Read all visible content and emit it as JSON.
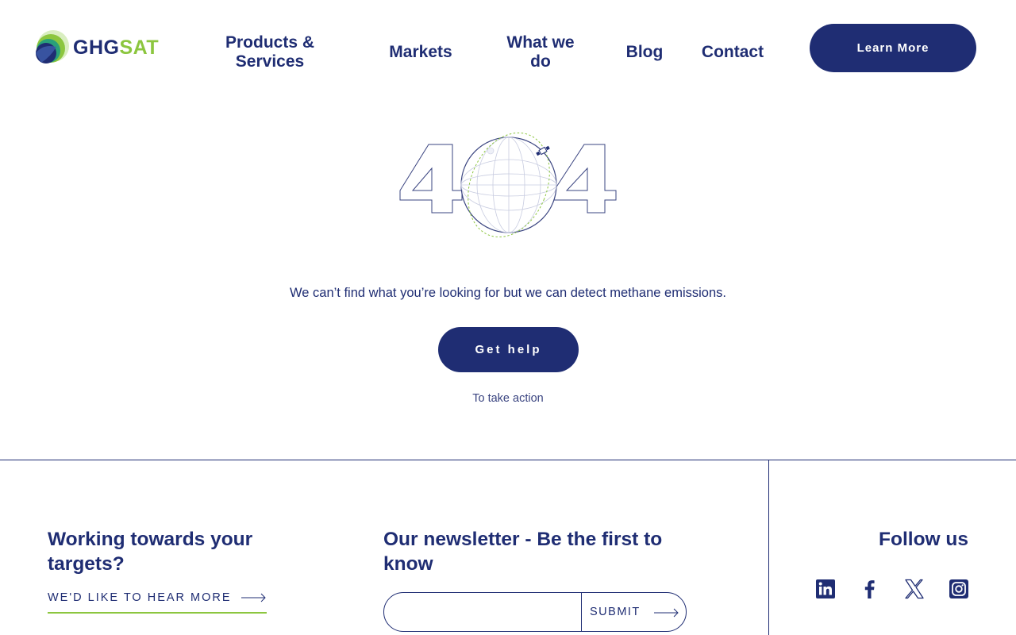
{
  "brand": {
    "logo_primary": "GHG",
    "logo_accent": "SAT",
    "navy": "#1f2d73",
    "green": "#8cc63f"
  },
  "nav": {
    "items": [
      {
        "label": "Products & Services"
      },
      {
        "label": "Markets"
      },
      {
        "label": "What we do"
      },
      {
        "label": "Blog"
      },
      {
        "label": "Contact"
      }
    ],
    "cta_label": "Learn More"
  },
  "error": {
    "code_left": "4",
    "code_right": "4",
    "message": "We can’t find what you’re looking for but we can detect methane emissions.",
    "help_button": "Get help",
    "help_caption": "To take action"
  },
  "footer": {
    "targets_heading": "Working towards your targets?",
    "hear_more_link": "WE'D LIKE TO HEAR MORE",
    "newsletter_heading": "Our newsletter - Be the first to know",
    "newsletter_placeholder": "",
    "submit_label": "SUBMIT",
    "follow_heading": "Follow us",
    "social_icons": [
      "linkedin-icon",
      "facebook-icon",
      "x-icon",
      "instagram-icon"
    ]
  }
}
